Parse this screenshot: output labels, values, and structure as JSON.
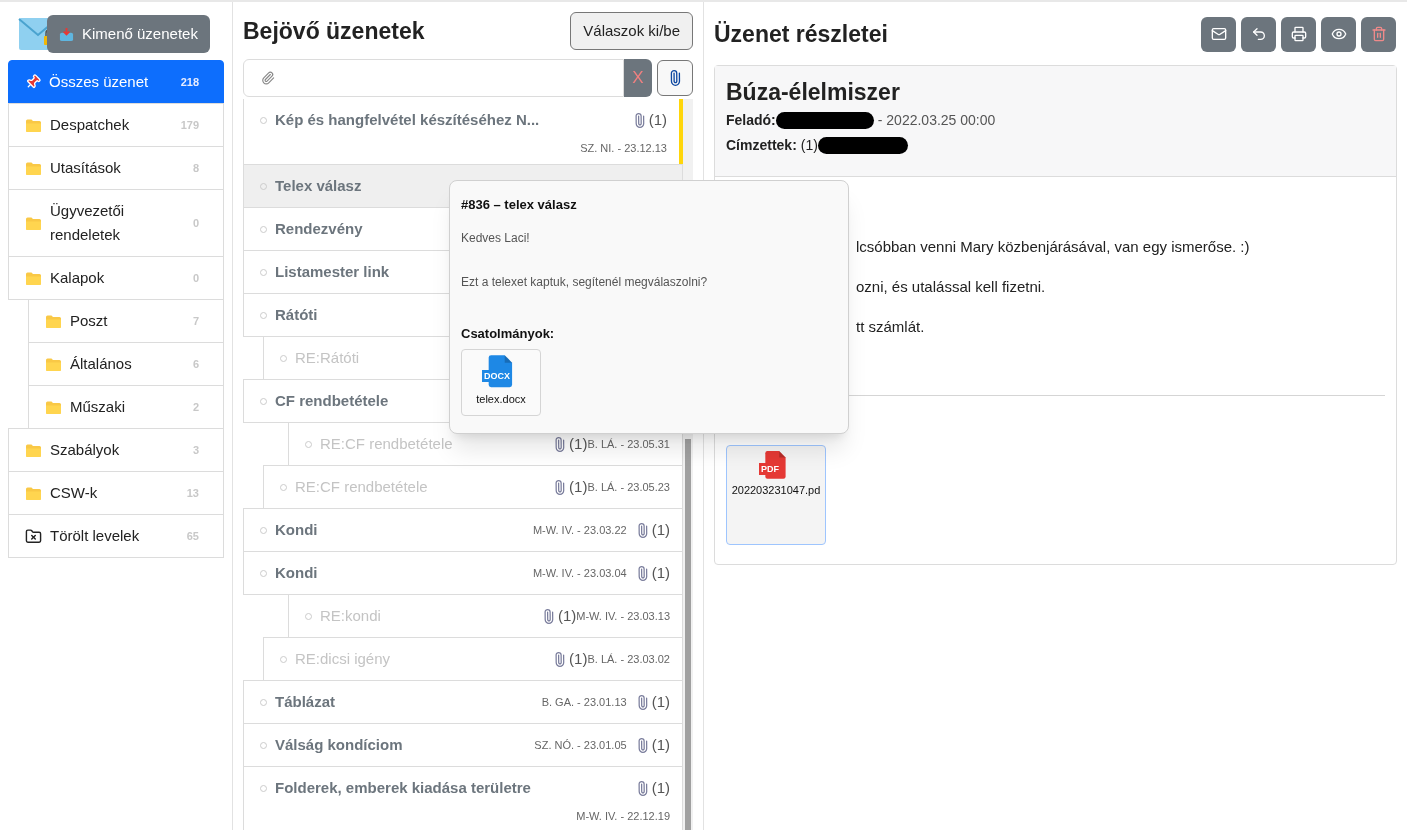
{
  "sidebar": {
    "outbox_button": "Kimenő üzenetek",
    "folders": [
      {
        "label": "Összes üzenet",
        "count": "218",
        "kind": "pinned",
        "selected": true
      },
      {
        "label": "Despatchek",
        "count": "179",
        "kind": "folder",
        "selected": false
      },
      {
        "label": "Utasítások",
        "count": "8",
        "kind": "folder",
        "selected": false
      },
      {
        "label": "Ügyvezetői rendeletek",
        "count": "0",
        "kind": "folder",
        "selected": false
      },
      {
        "label": "Kalapok",
        "count": "0",
        "kind": "folder",
        "selected": false,
        "children": [
          {
            "label": "Poszt",
            "count": "7",
            "kind": "folder",
            "selected": false
          },
          {
            "label": "Általános",
            "count": "6",
            "kind": "folder",
            "selected": false
          },
          {
            "label": "Műszaki",
            "count": "2",
            "kind": "folder",
            "selected": false
          }
        ]
      },
      {
        "label": "Szabályok",
        "count": "3",
        "kind": "folder",
        "selected": false
      },
      {
        "label": "CSW-k",
        "count": "13",
        "kind": "folder",
        "selected": false
      },
      {
        "label": "Törölt levelek",
        "count": "65",
        "kind": "trash",
        "selected": false
      }
    ]
  },
  "inbox": {
    "title": "Bejövő üzenetek",
    "toggle_button": "Válaszok ki/be",
    "clear_button": "X",
    "messages": [
      {
        "title": "Kép és hangfelvétel készítéséhez N...",
        "meta": "SZ. NI. - 23.12.13",
        "attachments": "(1)",
        "kind": "two-line",
        "selected": false,
        "flagged": true
      },
      {
        "title": "Telex válasz",
        "kind": "plain",
        "selected": true
      },
      {
        "title": "Rendezvény",
        "kind": "plain",
        "selected": false
      },
      {
        "title": "Listamester link",
        "kind": "plain",
        "selected": false
      },
      {
        "title": "Rátóti",
        "kind": "plain",
        "selected": false,
        "children": [
          {
            "title": "RE:Rátóti",
            "kind": "plain",
            "selected": false
          }
        ]
      },
      {
        "title": "CF rendbetétele",
        "kind": "plain",
        "selected": false,
        "children": [
          {
            "title": "RE:CF rendbetétele",
            "meta": "B. LÁ. - 23.05.23",
            "attachments": "(1)",
            "kind": "reply",
            "selected": false,
            "flagged": false,
            "children": [
              {
                "title": "RE:CF rendbetétele",
                "meta": "B. LÁ. - 23.05.31",
                "attachments": "(1)",
                "kind": "reply",
                "selected": false,
                "flagged": false
              }
            ]
          }
        ]
      },
      {
        "title": "Kondi",
        "meta": "M-W. IV. - 23.03.22",
        "attachments": "(1)",
        "kind": "thread",
        "selected": false,
        "flagged": false
      },
      {
        "title": "Kondi",
        "meta": "M-W. IV. - 23.03.04",
        "attachments": "(1)",
        "kind": "thread",
        "selected": false,
        "flagged": false,
        "children": [
          {
            "title": "RE:dicsi igény",
            "meta": "B. LÁ. - 23.03.02",
            "attachments": "(1)",
            "kind": "reply",
            "selected": false,
            "flagged": false,
            "children": [
              {
                "title": "RE:kondi",
                "meta": "M-W. IV. - 23.03.13",
                "attachments": "(1)",
                "kind": "reply",
                "selected": false,
                "flagged": false
              }
            ]
          }
        ]
      },
      {
        "title": "Táblázat",
        "meta": "B. GA. - 23.01.13",
        "attachments": "(1)",
        "kind": "thread",
        "selected": false,
        "flagged": false
      },
      {
        "title": "Válság kondíciom",
        "meta": "SZ. NÓ. - 23.01.05",
        "attachments": "(1)",
        "kind": "thread",
        "selected": false,
        "flagged": false
      },
      {
        "title": "Folderek, emberek kiadása területre",
        "meta": "M-W. IV. - 22.12.19",
        "attachments": "(1)",
        "kind": "two-line",
        "selected": false,
        "flagged": false
      }
    ]
  },
  "preview_popover": {
    "title": "#836 – telex válasz",
    "paragraphs": [
      "Kedves Laci!",
      "Ezt a telexet kaptuk, segítenél megválaszolni?"
    ],
    "attachments_label": "Csatolmányok:",
    "attachments": [
      {
        "name": "telex.docx",
        "type": "DOCX"
      }
    ]
  },
  "details": {
    "title": "Üzenet részletei",
    "subject": "Búza-élelmiszer",
    "sender_label": "Feladó:",
    "date": "- 2022.03.25 00:00",
    "recipients_label": "Címzettek:",
    "recipients_count": "(1)",
    "body_fragments": [
      "lcsóbban venni Mary közbenjárásával, van egy ismerőse. :)",
      "ozni, és utalással kell fizetni.",
      "tt számlát."
    ],
    "attachments": [
      {
        "name": "202203231047.pd",
        "type": "PDF"
      }
    ]
  }
}
